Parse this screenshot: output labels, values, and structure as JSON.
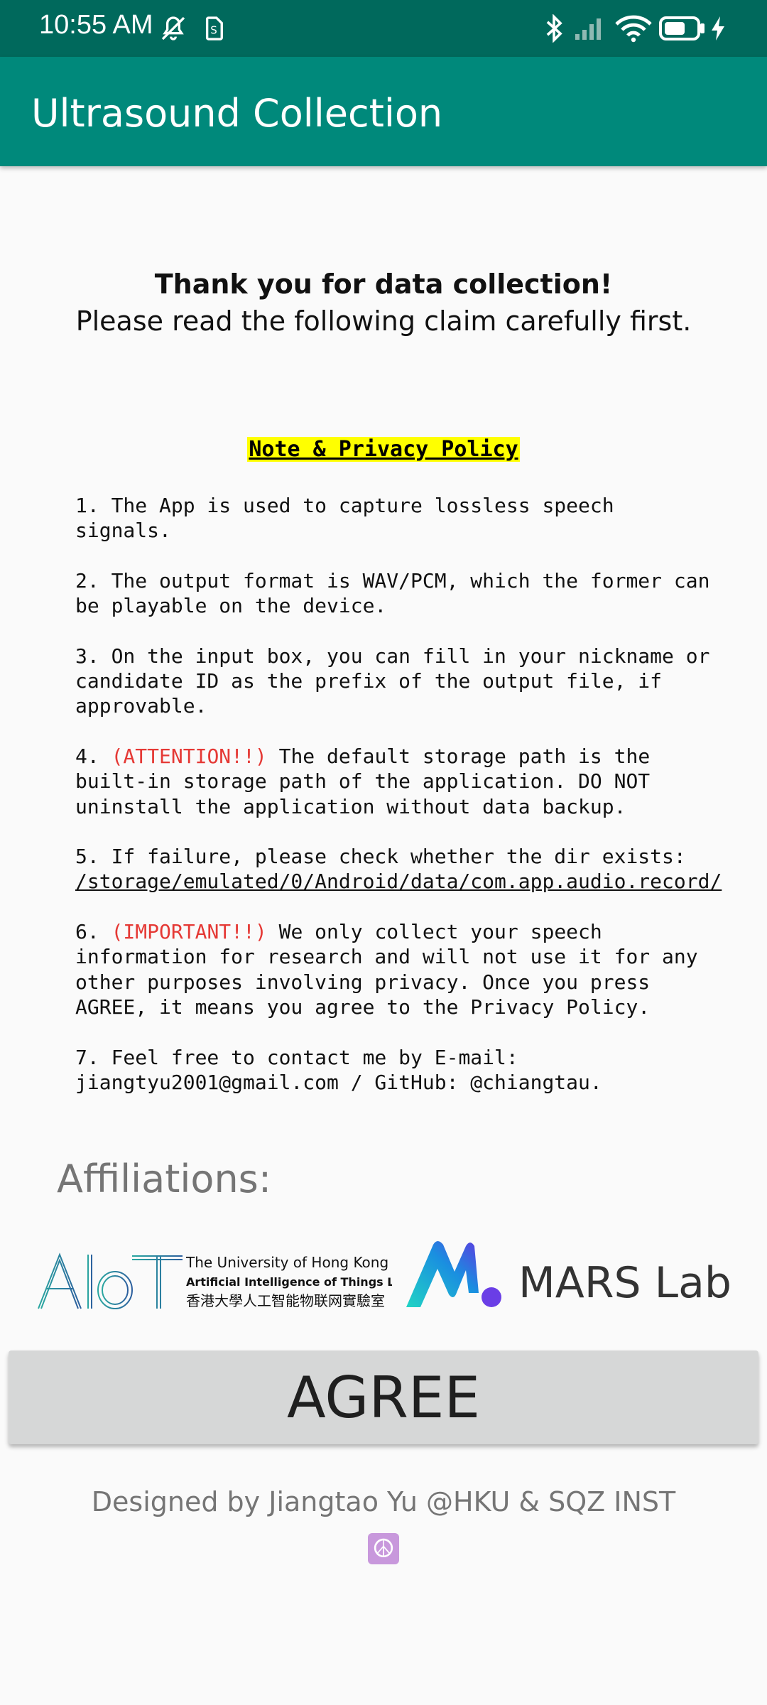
{
  "status_bar": {
    "time": "10:55 AM",
    "icons": [
      "mute-icon",
      "sim-icon",
      "bluetooth-icon",
      "signal-icon",
      "wifi-icon",
      "battery-icon",
      "charging-icon"
    ]
  },
  "app_bar": {
    "title": "Ultrasound Collection",
    "color": "#00897b"
  },
  "intro": {
    "heading": "Thank you for data collection!",
    "subheading": "Please read the following claim carefully first."
  },
  "policy": {
    "title": "Note & Privacy Policy",
    "item1": "1. The App is used to capture lossless speech signals.",
    "item2": "2. The output format is WAV/PCM, which the former can be playable on the device.",
    "item3": "3. On the input box, you can fill in your nickname or candidate ID as the prefix of the output file, if approvable.",
    "item4_prefix": "4. ",
    "item4_flag": "(ATTENTION!!)",
    "item4_text": " The default storage path is the built-in storage path of the application. DO NOT uninstall the application without data backup.",
    "item5_text": "5. If failure, please check whether the dir exists:",
    "item5_path": "/storage/emulated/0/Android/data/com.app.audio.record/",
    "item6_prefix": "6. ",
    "item6_flag": "(IMPORTANT!!)",
    "item6_text": " We only collect your speech information for research and will not use it for any other purposes involving privacy. Once you press AGREE, it means you agree to the Privacy Policy.",
    "item7": "7. Feel free to contact me by E-mail: jiangtyu2001@gmail.com / GitHub: @chiangtau."
  },
  "affiliations": {
    "label": "Affiliations:",
    "aiot_logo": {
      "mark": "AIoT",
      "line1": "The University of Hong Kong",
      "line2": "Artificial Intelligence of Things Lab",
      "line3": "香港大學人工智能物联网實驗室"
    },
    "mars_logo": {
      "text": "MARS Lab"
    }
  },
  "agree_button": {
    "label": "AGREE"
  },
  "footer": {
    "text": "Designed by Jiangtao Yu @HKU & SQZ INST",
    "emoji": "☮"
  }
}
